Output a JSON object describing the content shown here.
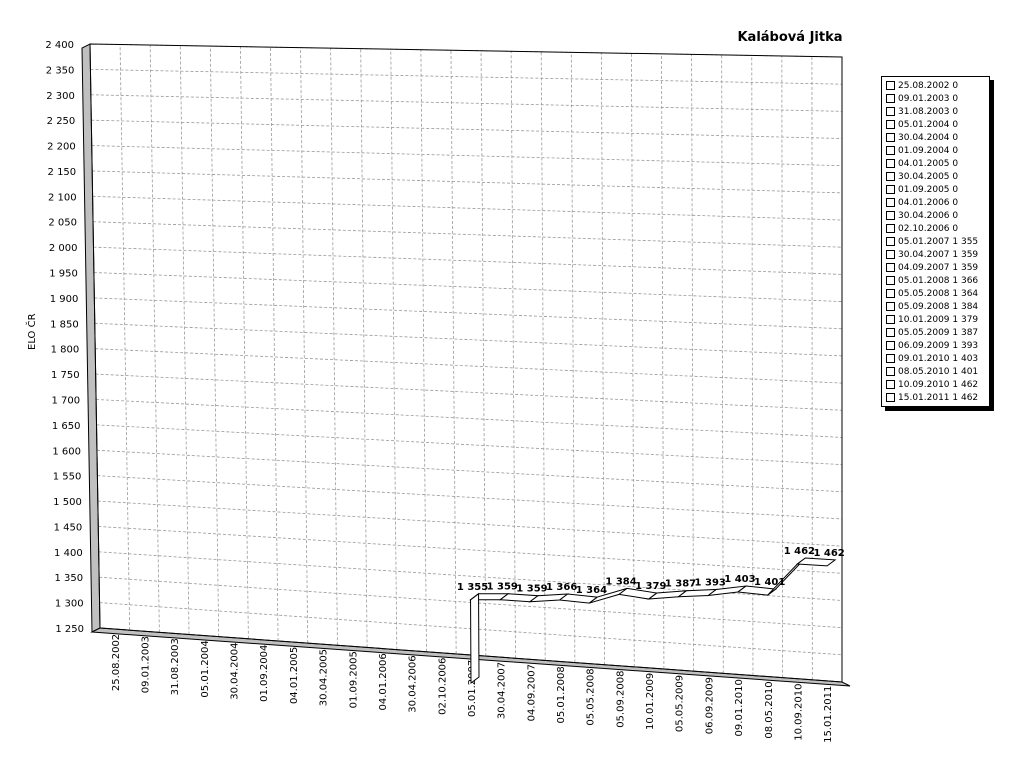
{
  "chart_data": {
    "type": "line",
    "title": "Kalábová Jitka",
    "ylabel": "ELO ČR",
    "xlabel": "",
    "ylim": [
      1250,
      2400
    ],
    "yticks": [
      1250,
      1300,
      1350,
      1400,
      1450,
      1500,
      1550,
      1600,
      1650,
      1700,
      1750,
      1800,
      1850,
      1900,
      1950,
      2000,
      2050,
      2100,
      2150,
      2200,
      2250,
      2300,
      2350,
      2400
    ],
    "ytick_labels": [
      "1 250",
      "1 300",
      "1 350",
      "1 400",
      "1 450",
      "1 500",
      "1 550",
      "1 600",
      "1 650",
      "1 700",
      "1 750",
      "1 800",
      "1 850",
      "1 900",
      "1 950",
      "2 000",
      "2 050",
      "2 100",
      "2 150",
      "2 200",
      "2 250",
      "2 300",
      "2 350",
      "2 400"
    ],
    "grid": true,
    "legend_position": "right",
    "categories": [
      "25.08.2002",
      "09.01.2003",
      "31.08.2003",
      "05.01.2004",
      "30.04.2004",
      "01.09.2004",
      "04.01.2005",
      "30.04.2005",
      "01.09.2005",
      "04.01.2006",
      "30.04.2006",
      "02.10.2006",
      "05.01.2007",
      "30.04.2007",
      "04.09.2007",
      "05.01.2008",
      "05.05.2008",
      "05.09.2008",
      "10.01.2009",
      "05.05.2009",
      "06.09.2009",
      "09.01.2010",
      "08.05.2010",
      "10.09.2010",
      "15.01.2011"
    ],
    "values": [
      0,
      0,
      0,
      0,
      0,
      0,
      0,
      0,
      0,
      0,
      0,
      0,
      1355,
      1359,
      1359,
      1366,
      1364,
      1384,
      1379,
      1387,
      1393,
      1403,
      1401,
      1462,
      1462
    ],
    "data_labels": [
      "",
      "",
      "",
      "",
      "",
      "",
      "",
      "",
      "",
      "",
      "",
      "",
      "1 355",
      "1 359",
      "1 359",
      "1 366",
      "1 364",
      "1 384",
      "1 379",
      "1 387",
      "1 393",
      "1 403",
      "1 401",
      "1 462",
      "1 462"
    ],
    "legend": [
      "25.08.2002 0",
      "09.01.2003 0",
      "31.08.2003 0",
      "05.01.2004 0",
      "30.04.2004 0",
      "01.09.2004 0",
      "04.01.2005 0",
      "30.04.2005 0",
      "01.09.2005 0",
      "04.01.2006 0",
      "30.04.2006 0",
      "02.10.2006 0",
      "05.01.2007 1 355",
      "30.04.2007 1 359",
      "04.09.2007 1 359",
      "05.01.2008 1 366",
      "05.05.2008 1 364",
      "05.09.2008 1 384",
      "10.01.2009 1 379",
      "05.05.2009 1 387",
      "06.09.2009 1 393",
      "09.01.2010 1 403",
      "08.05.2010 1 401",
      "10.09.2010 1 462",
      "15.01.2011 1 462"
    ]
  }
}
